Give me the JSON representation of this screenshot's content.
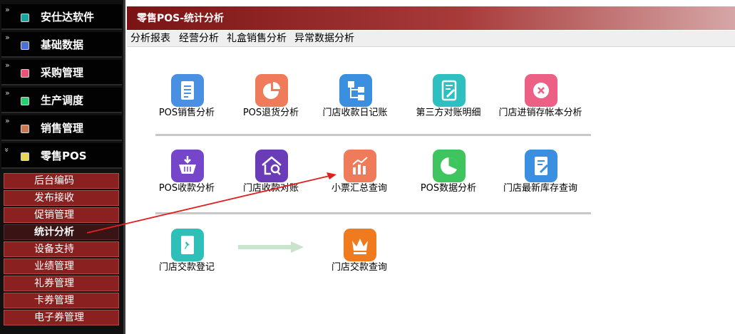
{
  "sidebar": {
    "chevron_collapsed": "»",
    "chevron_expanded": "»",
    "menus": [
      {
        "label": "安仕达软件",
        "color": "#16a79d"
      },
      {
        "label": "基础数据",
        "color": "#4a72d6"
      },
      {
        "label": "采购管理",
        "color": "#e8537a"
      },
      {
        "label": "生产调度",
        "color": "#2ecc71"
      },
      {
        "label": "销售管理",
        "color": "#c97a52"
      },
      {
        "label": "零售POS",
        "color": "#e8d552"
      }
    ],
    "sub_items": [
      {
        "label": "后台编码"
      },
      {
        "label": "发布接收"
      },
      {
        "label": "促销管理"
      },
      {
        "label": "统计分析"
      },
      {
        "label": "设备支持"
      },
      {
        "label": "业绩管理"
      },
      {
        "label": "礼券管理"
      },
      {
        "label": "卡券管理"
      },
      {
        "label": "电子券管理"
      }
    ]
  },
  "header": {
    "title": "零售POS-统计分析"
  },
  "tabs": [
    {
      "label": "分析报表"
    },
    {
      "label": "经营分析"
    },
    {
      "label": "礼盒销售分析"
    },
    {
      "label": "异常数据分析"
    }
  ],
  "tiles": [
    {
      "label": "POS销售分析",
      "color": "#4a90e2",
      "icon": "document-icon"
    },
    {
      "label": "POS退货分析",
      "color": "#ef7b5a",
      "icon": "pie-chart-icon"
    },
    {
      "label": "门店收款日记账",
      "color": "#3a8fe0",
      "icon": "hierarchy-icon"
    },
    {
      "label": "第三方对账明细",
      "color": "#2ec0c0",
      "icon": "notebook-icon"
    },
    {
      "label": "门店进销存帐本分析",
      "color": "#ec6085",
      "icon": "close-icon"
    },
    {
      "label": "POS收款分析",
      "color": "#7546c9",
      "icon": "basket-icon"
    },
    {
      "label": "门店收款对账",
      "color": "#6a3cb8",
      "icon": "house-search-icon"
    },
    {
      "label": "小票汇总查询",
      "color": "#ef7b5a",
      "icon": "bar-chart-icon"
    },
    {
      "label": "POS数据分析",
      "color": "#3ec55d",
      "icon": "pie-chart-icon"
    },
    {
      "label": "门店最新库存查询",
      "color": "#3a8fe0",
      "icon": "edit-document-icon"
    },
    {
      "label": "门店交款登记",
      "color": "#2ec0b8",
      "icon": "pin-icon"
    },
    {
      "label": "门店交款查询",
      "color": "#f07a1e",
      "icon": "crown-icon"
    }
  ]
}
